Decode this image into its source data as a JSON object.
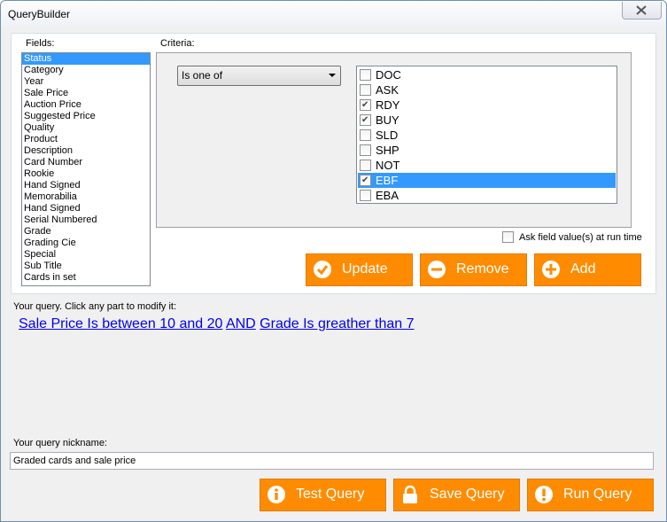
{
  "window": {
    "title": "QueryBuilder",
    "close_icon": "close-icon"
  },
  "fields": {
    "label": "Fields:",
    "selected_index": 0,
    "items": [
      "Status",
      "Category",
      "Year",
      "Sale Price",
      "Auction Price",
      "Suggested Price",
      "Quality",
      "Product",
      "Description",
      "Card Number",
      "Rookie",
      "Hand Signed",
      "Memorabilia",
      "Hand Signed",
      "Serial Numbered",
      "Grade",
      "Grading Cie",
      "Special",
      "Sub Title",
      "Cards in set"
    ]
  },
  "criteria": {
    "label": "Criteria:",
    "operator": "Is one of",
    "values": [
      {
        "label": "DOC",
        "checked": false,
        "selected": false
      },
      {
        "label": "ASK",
        "checked": false,
        "selected": false
      },
      {
        "label": "RDY",
        "checked": true,
        "selected": false
      },
      {
        "label": "BUY",
        "checked": true,
        "selected": false
      },
      {
        "label": "SLD",
        "checked": false,
        "selected": false
      },
      {
        "label": "SHP",
        "checked": false,
        "selected": false
      },
      {
        "label": "NOT",
        "checked": false,
        "selected": false
      },
      {
        "label": "EBF",
        "checked": true,
        "selected": true
      },
      {
        "label": "EBA",
        "checked": false,
        "selected": false
      }
    ],
    "ask_runtime_label": "Ask field value(s) at run time",
    "ask_runtime_checked": false
  },
  "actions": {
    "update": "Update",
    "remove": "Remove",
    "add": "Add"
  },
  "query": {
    "label": "Your query. Click any part to modify it:",
    "part1": "Sale Price Is between 10 and 20",
    "conj": "AND",
    "part2": "Grade Is greather than 7"
  },
  "nickname": {
    "label": "Your query nickname:",
    "value": "Graded cards and sale price"
  },
  "bottom": {
    "test": "Test Query",
    "save": "Save Query",
    "run": "Run Query"
  },
  "colors": {
    "accent": "#ff8c00",
    "selection": "#3399ff",
    "link": "#0000ee"
  }
}
